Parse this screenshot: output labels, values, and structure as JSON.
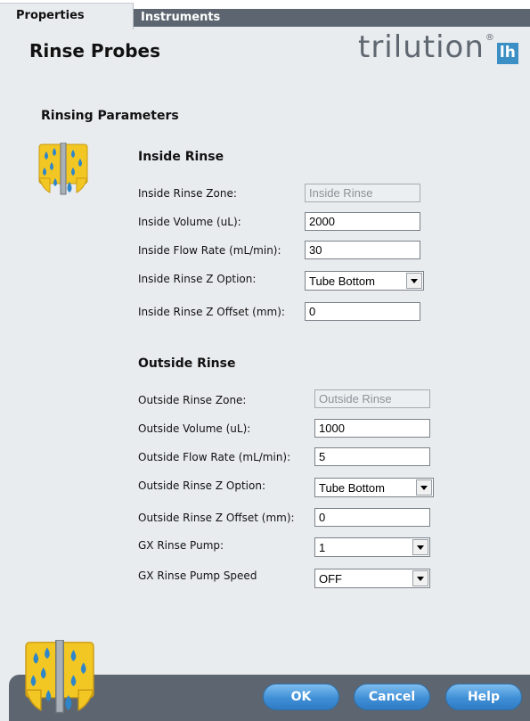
{
  "tabs": {
    "properties": "Properties",
    "instruments": "Instruments"
  },
  "header": {
    "title": "Rinse Probes",
    "logo": "trilution",
    "logo_reg": "®",
    "logo_badge": "lh"
  },
  "section": {
    "title": "Rinsing Parameters"
  },
  "inside": {
    "title": "Inside Rinse",
    "zone_label": "Inside Rinse Zone:",
    "zone_value": "Inside Rinse",
    "volume_label": "Inside Volume (uL):",
    "volume_value": "2000",
    "flow_label": "Inside Flow Rate (mL/min):",
    "flow_value": "30",
    "z_option_label": "Inside Rinse Z Option:",
    "z_option_value": "Tube Bottom",
    "z_offset_label": "Inside Rinse Z Offset (mm):",
    "z_offset_value": "0"
  },
  "outside": {
    "title": "Outside Rinse",
    "zone_label": "Outside Rinse Zone:",
    "zone_value": "Outside Rinse",
    "volume_label": "Outside Volume (uL):",
    "volume_value": "1000",
    "flow_label": "Outside Flow Rate (mL/min):",
    "flow_value": "5",
    "z_option_label": "Outside Rinse Z Option:",
    "z_option_value": "Tube Bottom",
    "z_offset_label": "Outside Rinse Z Offset (mm):",
    "z_offset_value": "0",
    "pump_label": "GX Rinse Pump:",
    "pump_value": "1",
    "pump_speed_label": "GX Rinse Pump Speed",
    "pump_speed_value": "OFF"
  },
  "footer": {
    "ok": "OK",
    "cancel": "Cancel",
    "help": "Help"
  },
  "icons": {
    "rinse": "rinse-probe-icon"
  },
  "colors": {
    "accent": "#3f8fd6",
    "panel": "#e9ecef",
    "dark_bar": "#5d6670",
    "icon_yellow": "#f2c623",
    "icon_drop": "#2e86c9"
  }
}
